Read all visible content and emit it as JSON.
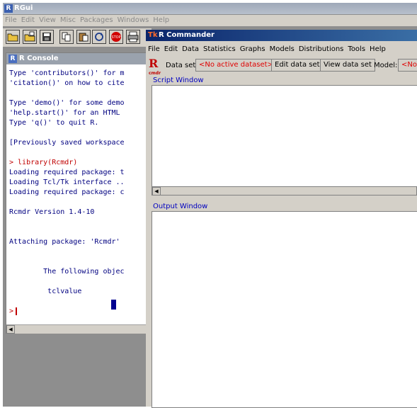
{
  "rgui": {
    "title": "RGui",
    "menu": [
      "File",
      "Edit",
      "View",
      "Misc",
      "Packages",
      "Windows",
      "Help"
    ],
    "toolbar_icons": [
      "open-folder-icon",
      "load-workspace-icon",
      "save-icon",
      "copy-icon",
      "paste-icon",
      "refresh-icon",
      "stop-icon",
      "print-icon"
    ]
  },
  "console": {
    "title": "R Console",
    "lines": [
      {
        "text": "Type 'contributors()' for m",
        "color": "blue"
      },
      {
        "text": "'citation()' on how to cite",
        "color": "blue"
      },
      {
        "text": "",
        "color": "blue"
      },
      {
        "text": "Type 'demo()' for some demo",
        "color": "blue"
      },
      {
        "text": "'help.start()' for an HTML",
        "color": "blue"
      },
      {
        "text": "Type 'q()' to quit R.",
        "color": "blue"
      },
      {
        "text": "",
        "color": "blue"
      },
      {
        "text": "[Previously saved workspace",
        "color": "blue"
      },
      {
        "text": "",
        "color": "blue"
      },
      {
        "text": "> library(Rcmdr)",
        "color": "red"
      },
      {
        "text": "Loading required package: t",
        "color": "blue"
      },
      {
        "text": "Loading Tcl/Tk interface ..",
        "color": "blue"
      },
      {
        "text": "Loading required package: c",
        "color": "blue"
      },
      {
        "text": "",
        "color": "blue"
      },
      {
        "text": "Rcmdr Version 1.4-10",
        "color": "blue"
      },
      {
        "text": "",
        "color": "blue"
      },
      {
        "text": "",
        "color": "blue"
      },
      {
        "text": "Attaching package: 'Rcmdr'",
        "color": "blue"
      },
      {
        "text": "",
        "color": "blue"
      },
      {
        "text": "",
        "color": "blue"
      },
      {
        "text": "        The following objec",
        "color": "blue"
      },
      {
        "text": "",
        "color": "blue"
      },
      {
        "text": "         tclvalue",
        "color": "blue"
      },
      {
        "text": "",
        "color": "blue"
      },
      {
        "text": ">",
        "color": "red"
      }
    ]
  },
  "rcmdr": {
    "title": "R Commander",
    "menu": [
      "File",
      "Edit",
      "Data",
      "Statistics",
      "Graphs",
      "Models",
      "Distributions",
      "Tools",
      "Help"
    ],
    "dataset_label": "Data set:",
    "dataset_value": "<No active dataset>",
    "edit_button": "Edit data set",
    "view_button": "View data set",
    "model_label": "Model:",
    "model_value": "<No a",
    "script_label": "Script Window",
    "output_label": "Output Window",
    "logo_letter": "R",
    "logo_sub": "cmdr"
  },
  "colors": {
    "console_text": "#000080",
    "console_red": "#c00000",
    "rcmdr_title": "#0a246a"
  }
}
